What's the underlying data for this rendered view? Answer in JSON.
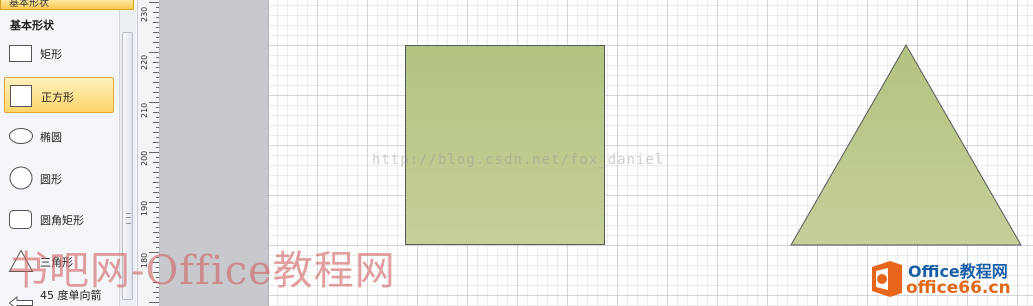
{
  "stencil": {
    "tab_label": "基本形状",
    "section_title": "基本形状",
    "items": [
      {
        "label": "矩形",
        "icon": "rectangle-icon"
      },
      {
        "label": "正方形",
        "icon": "square-icon",
        "selected": true
      },
      {
        "label": "椭圆",
        "icon": "ellipse-icon"
      },
      {
        "label": "圆形",
        "icon": "circle-icon"
      },
      {
        "label": "圆角矩形",
        "icon": "rounded-rectangle-icon"
      },
      {
        "label": "三角形",
        "icon": "triangle-icon"
      },
      {
        "label": "45 度单向箭",
        "icon": "arrow-icon"
      }
    ]
  },
  "ruler": {
    "labels": [
      "230",
      "220",
      "210",
      "200",
      "190",
      "180"
    ]
  },
  "canvas": {
    "shapes": [
      {
        "type": "square",
        "fill": "#b8c688",
        "stroke": "#595959"
      },
      {
        "type": "triangle",
        "fill": "#b8c688",
        "stroke": "#595959"
      }
    ]
  },
  "watermarks": {
    "url_text": "http://blog.csdn.net/fox_daniel",
    "site_text": "书吧网-Office教程网",
    "logo_line1": "Office教程网",
    "logo_line2": "office66.cn"
  },
  "colors": {
    "selected_item": "#fbd56b",
    "shape_fill": "#b8c688",
    "logo_orange": "#e8661b",
    "logo_blue": "#1a5fa8"
  }
}
